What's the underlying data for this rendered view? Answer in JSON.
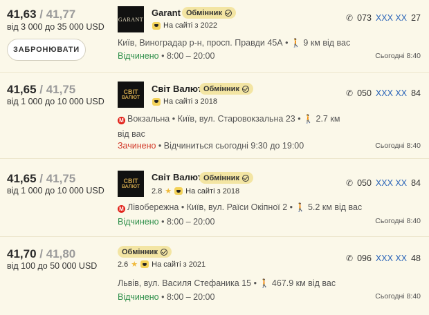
{
  "listings": [
    {
      "buy": "41,63",
      "sell": "41,77",
      "sep": " / ",
      "range": "від 3 000 до 35 000 USD",
      "book_label": "ЗАБРОНЮВАТИ",
      "logo_text": "GARANT",
      "name": "Garant",
      "badge": "Обмінник",
      "rating": "",
      "since": "На сайті з 2022",
      "address": "Київ, Виноградар р-н, просп. Правди 45А",
      "metro": "",
      "distance": "9 км від вас",
      "status": "Відчинено",
      "status_note": " • 8:00 – 20:00",
      "phone_prefix": "073",
      "phone_hidden": "XXX XX",
      "phone_suffix": "27",
      "updated": "Сьогодні 8:40"
    },
    {
      "buy": "41,65",
      "sell": "41,75",
      "sep": " / ",
      "range": "від 1 000 до 10 000 USD",
      "logo_line1": "СВІТ",
      "logo_line2": "ВАЛЮТ",
      "name": "Світ Валют",
      "badge": "Обмінник",
      "since": "На сайті з 2018",
      "metro": "Вокзальна",
      "address": "Київ, вул. Старовокзальна 23",
      "distance": "2.7 км від вас",
      "status": "Зачинено",
      "status_note": " • Відчиниться сьогодні 9:30 до 19:00",
      "phone_prefix": "050",
      "phone_hidden": "XXX XX",
      "phone_suffix": "84",
      "updated": "Сьогодні 8:40"
    },
    {
      "buy": "41,65",
      "sell": "41,75",
      "sep": " / ",
      "range": "від 1 000 до 10 000 USD",
      "logo_line1": "СВІТ",
      "logo_line2": "ВАЛЮТ",
      "name": "Світ Валют",
      "badge": "Обмінник",
      "rating": "2.8",
      "since": "На сайті з 2018",
      "metro": "Лівобережна",
      "address": "Київ, вул. Раїси Окіпної 2",
      "distance": "5.2 км від вас",
      "status": "Відчинено",
      "status_note": " • 8:00 – 20:00",
      "phone_prefix": "050",
      "phone_hidden": "XXX XX",
      "phone_suffix": "84",
      "updated": "Сьогодні 8:40"
    },
    {
      "buy": "41,70",
      "sell": "41,80",
      "sep": " / ",
      "range": "від 100 до 50 000 USD",
      "badge": "Обмінник",
      "rating": "2.6",
      "since": "На сайті з 2021",
      "address": "Львів, вул. Василя Стефаника 15",
      "distance": "467.9 км від вас",
      "status": "Відчинено",
      "status_note": " • 8:00 – 20:00",
      "phone_prefix": "096",
      "phone_hidden": "XXX XX",
      "phone_suffix": "48",
      "updated": "Сьогодні 8:40"
    }
  ],
  "icons": {
    "phone": "phone-icon",
    "walk": "walking-person-icon",
    "metro": "metro-icon",
    "verified": "check-circle-icon",
    "star": "star-icon",
    "since": "site-badge-icon"
  },
  "colors": {
    "background": "#fbf8e9",
    "badge": "#f3e5a3",
    "open": "#2e8f4a",
    "closed": "#d23a2a",
    "phone_hidden": "#2a64b8",
    "star": "#f0b93a",
    "metro": "#e2231a"
  }
}
